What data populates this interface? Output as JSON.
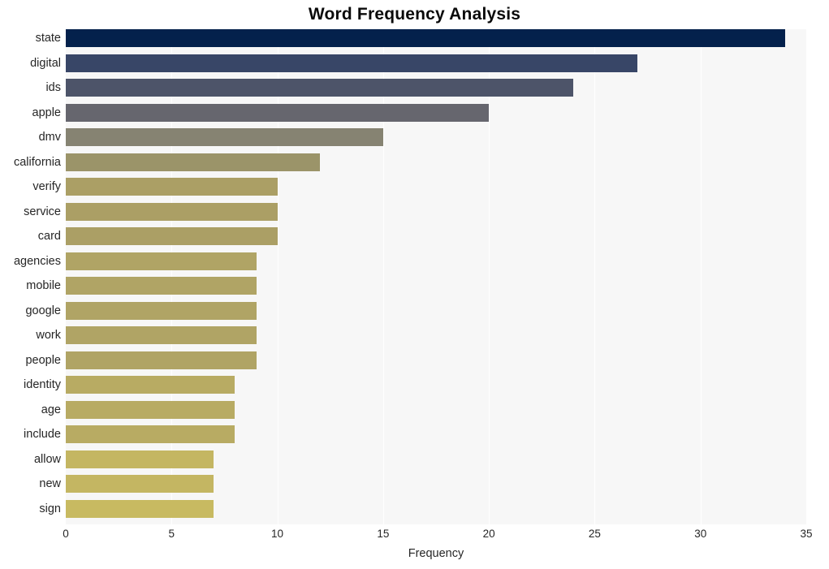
{
  "chart_data": {
    "type": "bar",
    "orientation": "horizontal",
    "title": "Word Frequency Analysis",
    "xlabel": "Frequency",
    "ylabel": "",
    "xlim": [
      0,
      35
    ],
    "ylim": [
      0,
      20
    ],
    "grid": true,
    "legend": null,
    "x_ticks": [
      "0",
      "5",
      "10",
      "15",
      "20",
      "25",
      "30",
      "35"
    ],
    "x_tick_values": [
      0,
      5,
      10,
      15,
      20,
      25,
      30,
      35
    ],
    "categories": [
      "state",
      "digital",
      "ids",
      "apple",
      "dmv",
      "california",
      "verify",
      "service",
      "card",
      "agencies",
      "mobile",
      "google",
      "work",
      "people",
      "identity",
      "age",
      "include",
      "allow",
      "new",
      "sign"
    ],
    "values": [
      34,
      27,
      24,
      20,
      15,
      12,
      10,
      10,
      10,
      9,
      9,
      9,
      9,
      9,
      8,
      8,
      8,
      7,
      7,
      7
    ],
    "bar_colors": [
      "#04214c",
      "#384667",
      "#4d5469",
      "#66666e",
      "#868372",
      "#9b9469",
      "#ab9f65",
      "#ab9f65",
      "#ab9f65",
      "#b0a465",
      "#b0a465",
      "#b0a465",
      "#b0a465",
      "#b0a465",
      "#b8ab63",
      "#b8ab63",
      "#b8ab63",
      "#c4b662",
      "#c4b662",
      "#c8ba61"
    ],
    "plot_background": "#f7f7f7",
    "figure_background": "#ffffff",
    "gridline_color": "#ffffff",
    "text_color": "#262626"
  }
}
